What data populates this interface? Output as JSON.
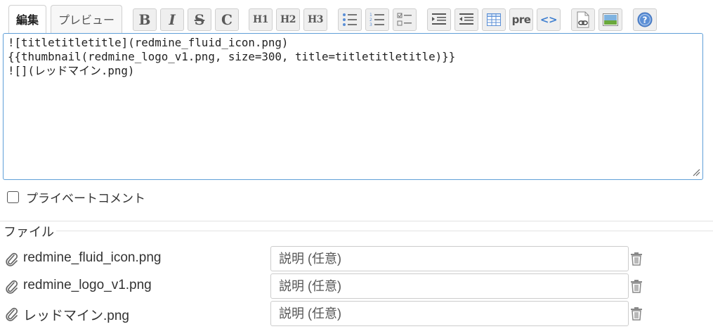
{
  "tabs": [
    {
      "label": "編集",
      "selected": true
    },
    {
      "label": "プレビュー",
      "selected": false
    }
  ],
  "toolbar": {
    "bold": "B",
    "italic": "I",
    "strike": "S",
    "code": "C",
    "h1": "H1",
    "h2": "H2",
    "h3": "H3",
    "pre": "pre",
    "code_highlight": "<>",
    "icons": [
      "bold-icon",
      "italic-icon",
      "strikethrough-icon",
      "inline-code-icon",
      "heading1-icon",
      "heading2-icon",
      "heading3-icon",
      "unordered-list-icon",
      "ordered-list-icon",
      "task-list-icon",
      "indent-icon",
      "outdent-icon",
      "table-icon",
      "preformatted-icon",
      "code-highlight-icon",
      "link-icon",
      "image-icon",
      "help-icon"
    ]
  },
  "editor": {
    "content": "![titletitletitle](redmine_fluid_icon.png)\n{{thumbnail(redmine_logo_v1.png, size=300, title=titletitletitle)}}\n![](レッドマイン.png)"
  },
  "private_comment": {
    "label": "プライベートコメント",
    "checked": false
  },
  "files": {
    "legend": "ファイル",
    "items": [
      {
        "name": "redmine_fluid_icon.png",
        "description_placeholder": "説明 (任意)"
      },
      {
        "name": "redmine_logo_v1.png",
        "description_placeholder": "説明 (任意)"
      },
      {
        "name": "レッドマイン.png",
        "description_placeholder": "説明 (任意)"
      }
    ]
  },
  "colors": {
    "editor_border": "#5f9fd8",
    "toolbar_button_bg": "#efefef",
    "help_icon": "#5b8fd6"
  }
}
